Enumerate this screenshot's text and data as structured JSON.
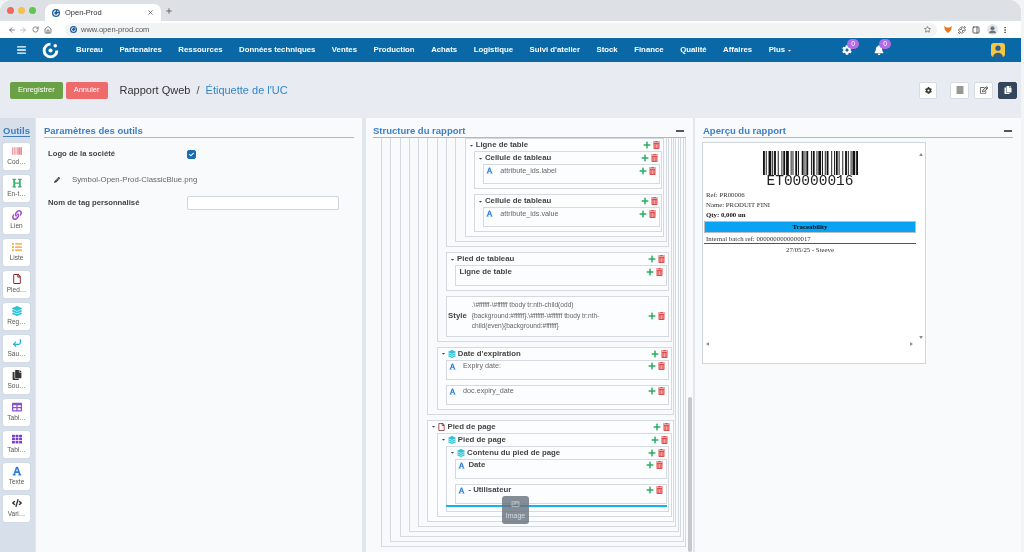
{
  "browser": {
    "tab": {
      "title": "Open-Prod",
      "selected": true
    },
    "url": "www.open-prod.com"
  },
  "navbar": {
    "items": [
      {
        "label": "Bureau",
        "kind": "link"
      },
      {
        "label": "Partenaires",
        "kind": "link"
      },
      {
        "label": "Ressources",
        "kind": "link"
      },
      {
        "label": "Données techniques",
        "kind": "link"
      },
      {
        "label": "Ventes",
        "kind": "link"
      },
      {
        "label": "Production",
        "kind": "link"
      },
      {
        "label": "Achats",
        "kind": "link"
      },
      {
        "label": "Logistique",
        "kind": "link"
      },
      {
        "label": "Suivi d'atelier",
        "kind": "link"
      },
      {
        "label": "Stock",
        "kind": "link"
      },
      {
        "label": "Finance",
        "kind": "link"
      },
      {
        "label": "Qualité",
        "kind": "link"
      },
      {
        "label": "Affaires",
        "kind": "link"
      },
      {
        "label": "Plus",
        "kind": "dropdown"
      }
    ],
    "settings_badge": "0",
    "notifications_badge": "0"
  },
  "toolbar": {
    "buttons": [
      {
        "label": "Enregistrer",
        "kind": "save"
      },
      {
        "label": "Annuler",
        "kind": "cancel"
      }
    ],
    "breadcrumb": [
      {
        "label": "Rapport Qweb",
        "kind": "parent"
      },
      {
        "label": "Étiquette de l'UC",
        "kind": "current"
      }
    ],
    "breadcrumb_separator": "/",
    "view_modes": [
      {
        "kind": "list",
        "selected": false
      },
      {
        "kind": "form",
        "selected": false
      },
      {
        "kind": "designer",
        "selected": true
      }
    ]
  },
  "tools": {
    "title": "Outils",
    "items": [
      {
        "label": "Cod…",
        "kind": "barcode"
      },
      {
        "label": "En-t…",
        "kind": "heading"
      },
      {
        "label": "Lien",
        "kind": "link"
      },
      {
        "label": "Liste",
        "kind": "list"
      },
      {
        "label": "Pied…",
        "kind": "footer"
      },
      {
        "label": "Reg…",
        "kind": "region"
      },
      {
        "label": "Sau…",
        "kind": "break"
      },
      {
        "label": "Sou…",
        "kind": "subreport"
      },
      {
        "label": "Tabl…",
        "kind": "table"
      },
      {
        "label": "Tabl…",
        "kind": "grid"
      },
      {
        "label": "Texte",
        "kind": "text"
      },
      {
        "label": "Vari…",
        "kind": "variable"
      }
    ]
  },
  "settings": {
    "title": "Paramètres des outils",
    "fields": [
      {
        "kind": "checkbox",
        "label": "Logo de la société",
        "checked": true
      },
      {
        "kind": "file",
        "value": "Symbol-Open-Prod-ClassicBlue.png"
      },
      {
        "kind": "text",
        "label": "Nom de tag personnalisé"
      }
    ]
  },
  "structure": {
    "title": "Structure du rapport",
    "tree": [
      {
        "kind": "container",
        "children": [
          {
            "kind": "container",
            "children": [
              {
                "kind": "container",
                "children": [
                  {
                    "kind": "container",
                    "children": [
                      {
                        "kind": "container",
                        "children": [
                          {
                            "kind": "container",
                            "children": [
                              {
                                "kind": "container",
                                "children": [
                                  {
                                    "kind": "container",
                                    "children": [
                                      {
                                        "kind": "container",
                                        "children": [
                                          {
                                            "kind": "section",
                                            "label": "Ligne de table",
                                            "expanded": true,
                                            "children": [
                                              {
                                                "kind": "section",
                                                "label": "Cellule de tableau",
                                                "expanded": true,
                                                "children": [
                                                  {
                                                    "kind": "text",
                                                    "label": "attribute_ids.label",
                                                    "bold": false
                                                  }
                                                ]
                                              },
                                              {
                                                "kind": "section",
                                                "label": "Cellule de tableau",
                                                "expanded": true,
                                                "children": [
                                                  {
                                                    "kind": "text",
                                                    "label": "attribute_ids.value",
                                                    "bold": false
                                                  }
                                                ]
                                              }
                                            ]
                                          }
                                        ]
                                      }
                                    ]
                                  },
                                  {
                                    "kind": "section",
                                    "label": "Pied de tableau",
                                    "expanded": true,
                                    "children": [
                                      {
                                        "kind": "section",
                                        "label": "Ligne de table"
                                      }
                                    ]
                                  },
                                  {
                                    "kind": "style",
                                    "label": "Style",
                                    "value": ".\\#ffffff-\\#ffffff tbody tr:nth-child(odd){background:#ffffff}.\\#ffffff-\\#ffffff tbody tr:nth-child(even){background:#ffffff}"
                                  }
                                ]
                              },
                              {
                                "kind": "region",
                                "label": "Date d'expiration",
                                "expanded": true,
                                "children": [
                                  {
                                    "kind": "text",
                                    "label": "Expiry date:",
                                    "bold": false
                                  },
                                  {
                                    "kind": "text",
                                    "label": "doc.expiry_date",
                                    "bold": false
                                  }
                                ]
                              }
                            ]
                          },
                          {
                            "kind": "footer",
                            "label": "Pied de page",
                            "expanded": true,
                            "children": [
                              {
                                "kind": "region",
                                "label": "Pied de page",
                                "expanded": true,
                                "children": [
                                  {
                                    "kind": "region",
                                    "label": "Contenu du pied de page",
                                    "expanded": true,
                                    "children": [
                                      {
                                        "kind": "text",
                                        "label": "Date",
                                        "bold": true
                                      },
                                      {
                                        "kind": "text",
                                        "label": "- Utilisateur",
                                        "bold": true
                                      },
                                      {
                                        "kind": "drop_indicator"
                                      }
                                    ]
                                  }
                                ]
                              }
                            ]
                          }
                        ]
                      }
                    ]
                  }
                ]
              }
            ]
          }
        ]
      }
    ]
  },
  "preview": {
    "title": "Aperçu du rapport",
    "barcode": "ET00000016",
    "lines": [
      {
        "text": "Ref: PR00006",
        "bold": false
      },
      {
        "text": "Name: PRODUIT FINI",
        "bold": false
      },
      {
        "text": "Qty: 0,000 un",
        "bold": true
      }
    ],
    "band": "Traceability",
    "batch": "Internal batch ref: 0000000000000017",
    "footer": "27/05/25 - Steeve"
  },
  "drag_ghost": {
    "label": "Image"
  }
}
